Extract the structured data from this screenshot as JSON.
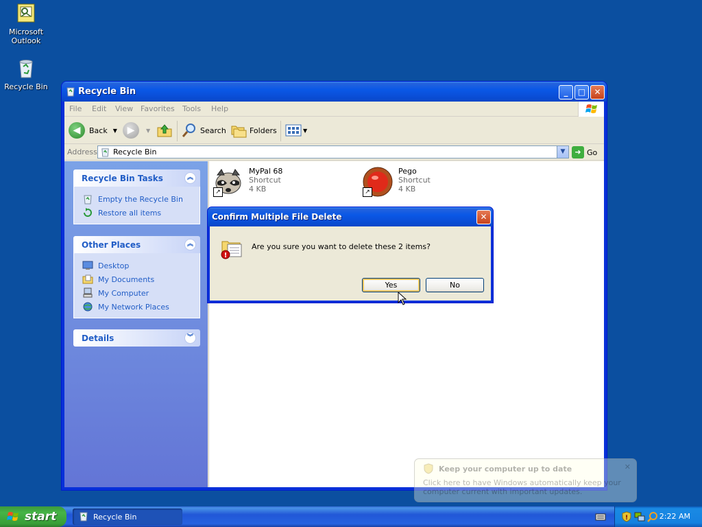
{
  "desktop": {
    "icons": [
      {
        "label": "Microsoft Outlook"
      },
      {
        "label": "Recycle Bin"
      }
    ]
  },
  "window": {
    "title": "Recycle Bin",
    "menu": [
      "File",
      "Edit",
      "View",
      "Favorites",
      "Tools",
      "Help"
    ],
    "toolbar": {
      "back_label": "Back",
      "search_label": "Search",
      "folders_label": "Folders"
    },
    "address": {
      "label": "Address",
      "value": "Recycle Bin",
      "go_label": "Go"
    },
    "sidebar": {
      "tasks": {
        "title": "Recycle Bin Tasks",
        "items": [
          "Empty the Recycle Bin",
          "Restore all items"
        ]
      },
      "places": {
        "title": "Other Places",
        "items": [
          "Desktop",
          "My Documents",
          "My Computer",
          "My Network Places"
        ]
      },
      "details": {
        "title": "Details"
      }
    },
    "files": [
      {
        "name": "MyPal 68",
        "type": "Shortcut",
        "size": "4 KB"
      },
      {
        "name": "Pego",
        "type": "Shortcut",
        "size": "4 KB"
      }
    ]
  },
  "dialog": {
    "title": "Confirm Multiple File Delete",
    "message": "Are you sure you want to delete these 2 items?",
    "yes_label": "Yes",
    "no_label": "No"
  },
  "taskbar": {
    "start_label": "start",
    "task_label": "Recycle Bin",
    "clock": "2:22 AM"
  },
  "balloon": {
    "title": "Keep your computer up to date",
    "body": "Click here to have Windows automatically keep your computer current with important updates."
  },
  "colors": {
    "desktop": "#0b4fa0",
    "titlebar": "#0a58e6",
    "link": "#215dc6",
    "start": "#46b446"
  }
}
